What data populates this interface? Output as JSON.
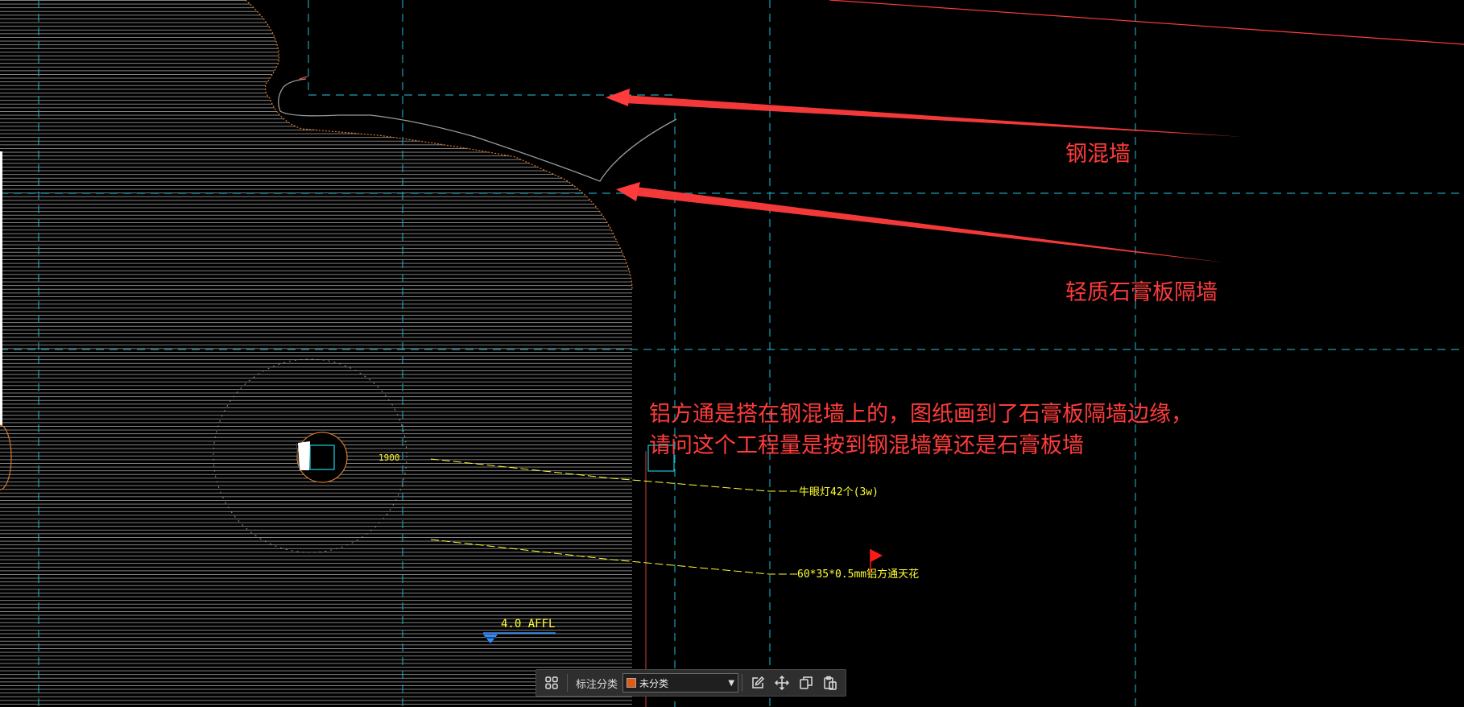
{
  "annotations": {
    "concrete_wall_label": "钢混墙",
    "gypsum_wall_label": "轻质石膏板隔墙",
    "question_line1": "铝方通是搭在钢混墙上的，图纸画到了石膏板隔墙边缘，",
    "question_line2": "请问这个工程量是按到钢混墙算还是石膏板墙",
    "color": "#ff3b3b"
  },
  "drawing": {
    "dim_1900": "1900",
    "downlight_label": "牛眼灯42个(3w)",
    "ceiling_label": "60*35*0.5mm铝方通天花",
    "level_label": "4.0 AFFL",
    "colors": {
      "hatch": "#8a8a8a",
      "grid": "#19a0b4",
      "outline": "#d4782a",
      "leader": "#ffff33",
      "level_marker": "#2f8fff",
      "flag": "#ff1a1a"
    }
  },
  "toolbar": {
    "category_label": "标注分类",
    "category_value": "未分类",
    "category_color": "#e05a10",
    "buttons": [
      "grid-icon",
      "edit-icon",
      "move-icon",
      "copy-icon",
      "paste-icon"
    ]
  }
}
